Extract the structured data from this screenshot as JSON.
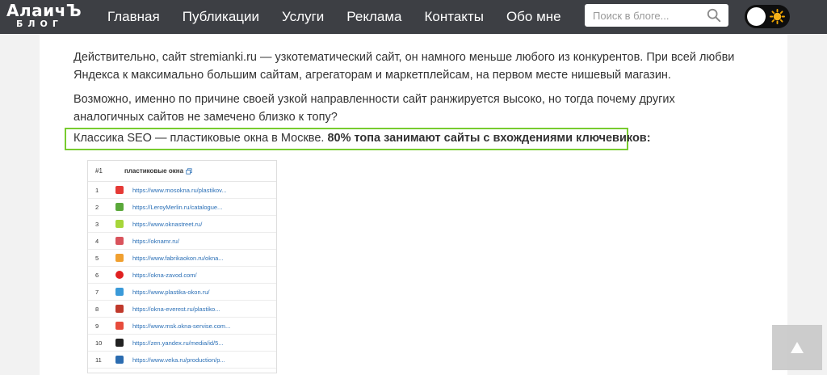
{
  "logo": {
    "title": "АлаичЪ",
    "subtitle": "БЛОГ"
  },
  "nav": [
    {
      "label": "Главная"
    },
    {
      "label": "Публикации"
    },
    {
      "label": "Услуги"
    },
    {
      "label": "Реклама"
    },
    {
      "label": "Контакты"
    },
    {
      "label": "Обо мне"
    }
  ],
  "search": {
    "placeholder": "Поиск в блоге...",
    "value": "",
    "icon": "search-icon"
  },
  "theme_toggle": {
    "icon": "sun-icon",
    "mode": "light"
  },
  "article": {
    "p1": "Действительно, сайт stremianki.ru — узкотематический сайт, он намного меньше любого из конкурентов. При всей любви Яндекса к максимально большим сайтам, агрегаторам и маркетплейсам, на первом месте нишевый магазин.",
    "p2": "Возможно, именно по причине своей узкой направленности сайт ранжируется высоко, но тогда почему других аналогичных сайтов не замечено близко к топу?",
    "highlight_text": "Классика SEO — пластиковые окна в Москве. ",
    "highlight_bold": "80% топа занимают сайты с вхождениями ключевиков:",
    "highlight_border_color": "#78cb2f"
  },
  "serp": {
    "col_num": "#1",
    "col_keyword": "пластиковые окна",
    "rows": [
      {
        "num": "1",
        "url": "https://www.mosokna.ru/plastikov...",
        "color": "#e53935"
      },
      {
        "num": "2",
        "url": "https://LeroyMerlin.ru/catalogue...",
        "color": "#5aa83a"
      },
      {
        "num": "3",
        "url": "https://www.oknastreet.ru/",
        "color": "#a6d63a"
      },
      {
        "num": "4",
        "url": "https://oknamr.ru/",
        "color": "#d9535c"
      },
      {
        "num": "5",
        "url": "https://www.fabrikaokon.ru/okna...",
        "color": "#f0a030"
      },
      {
        "num": "6",
        "url": "https://okna-zavod.com/",
        "color": "#e02020"
      },
      {
        "num": "7",
        "url": "https://www.plastika-okon.ru/",
        "color": "#3a9ad9"
      },
      {
        "num": "8",
        "url": "https://okna-everest.ru/plastiko...",
        "color": "#c0392b"
      },
      {
        "num": "9",
        "url": "https://www.msk.okna-servise.com...",
        "color": "#e74c3c"
      },
      {
        "num": "10",
        "url": "https://zen.yandex.ru/media/id/5...",
        "color": "#222222"
      },
      {
        "num": "11",
        "url": "https://www.veka.ru/production/p...",
        "color": "#2b6cb0"
      }
    ]
  },
  "scroll_top": {
    "label": "▲"
  },
  "colors": {
    "header_bg": "#3d3f44",
    "link": "#2a6fb6",
    "accent": "#78cb2f"
  }
}
